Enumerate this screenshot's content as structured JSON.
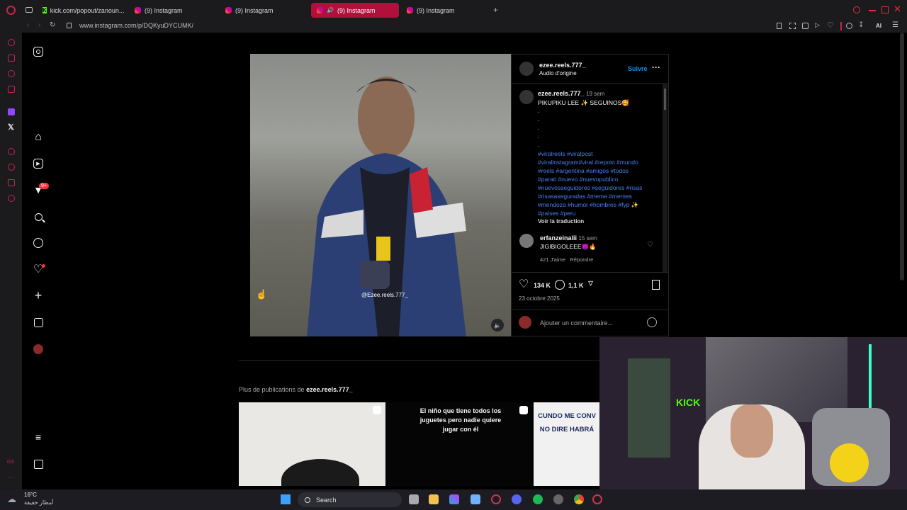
{
  "browser": {
    "tabs": [
      {
        "label": "kick.com/popout/zanoun...",
        "active": false
      },
      {
        "label": "(9) Instagram",
        "active": false
      },
      {
        "label": "(9) Instagram",
        "active": false
      },
      {
        "label": "(9) Instagram",
        "active": true
      },
      {
        "label": "(9) Instagram",
        "active": false
      }
    ],
    "url": "www.instagram.com/p/DQKyuDYCUMK/",
    "ai_label": "AI"
  },
  "ig_nav": {
    "notification_badge": "9+"
  },
  "post": {
    "header": {
      "username": "ezee.reels.777_",
      "audio": "Audio d'origine",
      "follow": "Suivre"
    },
    "caption": {
      "username": "ezee.reels.777_",
      "time": "19 sem",
      "text": "PIKUPIKU LEE ✨ SEGUINOS🥰",
      "dots": [
        ".",
        ".",
        ".",
        ".",
        "."
      ],
      "hashtag_lines": [
        "#viralreels #viralpost",
        "#viralinstagram#viral #repost #mundo",
        "#reels #argentina #amigos #todos",
        "#parati #nuevo #nuevopublico",
        "#nuevosseguidores #seguidores #risas",
        "#risasaseguradas #meme #memes",
        "#mendoza #humor #hombres #fyp ✨",
        "#paises #peru"
      ],
      "translate": "Voir la traduction"
    },
    "comment": {
      "username": "erfanzeinalii",
      "time": "15 sem",
      "text": "JIGIBIGOLEEE😈🔥",
      "likes": "421 J'aime",
      "reply": "Répondre"
    },
    "likes_count": "134 K",
    "comments_count": "1,1 K",
    "date": "23 octobre 2025",
    "add_comment_placeholder": "Ajouter un commentaire...",
    "video_watermark": "@Ezee.reels.777_"
  },
  "more_posts": {
    "prefix": "Plus de publications de ",
    "username": "ezee.reels.777_",
    "thumb2_text": "El niño que tiene todos los juguetes pero nadie quiere jugar con él",
    "thumb3_text": "CUNDO ME CONV NO DIRE HABRÁ"
  },
  "webcam": {
    "kick_sign": "KICK"
  },
  "taskbar": {
    "temp": "16°C",
    "weather": "أمطار خفيفة",
    "search": "Search"
  },
  "colors": {
    "accent": "#b0103a",
    "link": "#4a7ef0",
    "kick": "#53fc18"
  }
}
